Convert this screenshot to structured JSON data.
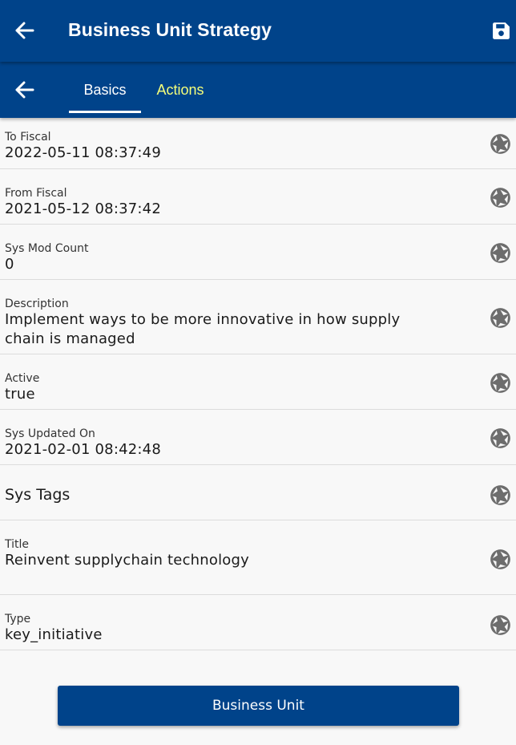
{
  "header": {
    "title": "Business Unit Strategy"
  },
  "tabs": [
    {
      "label": "Basics",
      "active": true
    },
    {
      "label": "Actions",
      "active": false
    }
  ],
  "fields": [
    {
      "label": "To Fiscal",
      "value": "2022-05-11 08:37:49"
    },
    {
      "label": "From Fiscal",
      "value": "2021-05-12 08:37:42"
    },
    {
      "label": "Sys Mod Count",
      "value": "0"
    },
    {
      "label": "Description",
      "value": "Implement ways to be more innovative in how supply chain is managed"
    },
    {
      "label": "Active",
      "value": "true"
    },
    {
      "label": "Sys Updated On",
      "value": "2021-02-01 08:42:48"
    },
    {
      "label": "Sys Tags",
      "value": ""
    },
    {
      "label": "Title",
      "value": "Reinvent supplychain technology"
    },
    {
      "label": "Type",
      "value": "key_initiative"
    }
  ],
  "footer": {
    "button_label": "Business Unit"
  },
  "colors": {
    "primary": "#00438a",
    "active_tab": "#ffffff",
    "inactive_tab": "#f5ff7a",
    "background": "#f8f8f8",
    "icon": "#6d6d6d"
  },
  "icons": {
    "back": "arrow-left-icon",
    "save": "floppy-disk-icon",
    "field_action": "aperture-icon"
  }
}
